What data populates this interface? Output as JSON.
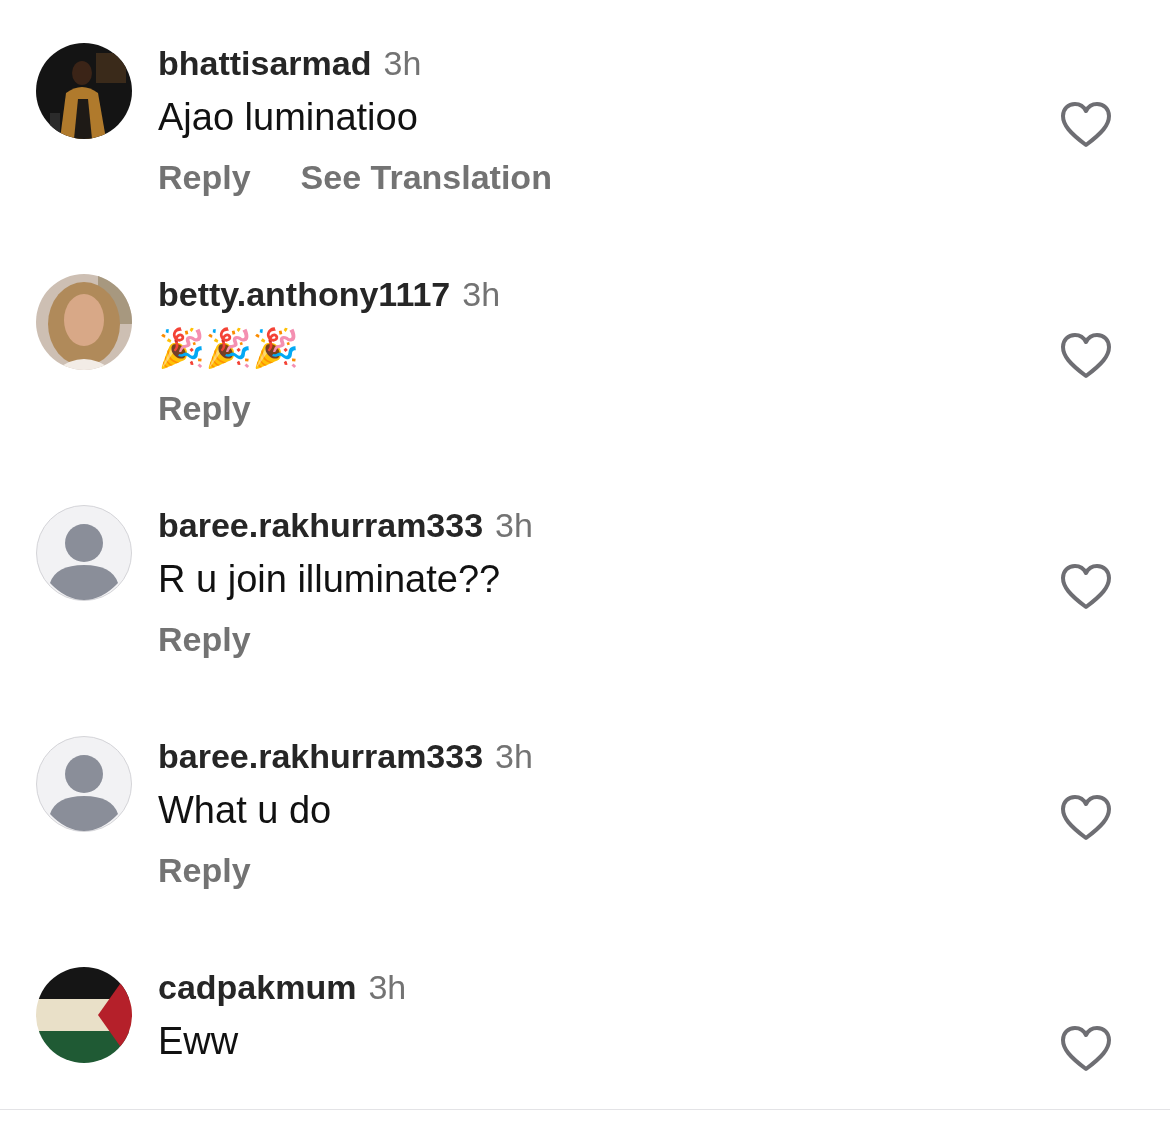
{
  "comments": [
    {
      "avatar": {
        "kind": "picture"
      },
      "username": "bhattisarmad",
      "time": "3h",
      "kind": "text",
      "text": "Ajao luminatioo",
      "actions": [
        "Reply",
        "See Translation"
      ],
      "liked": false
    },
    {
      "avatar": {
        "kind": "picture"
      },
      "username": "betty.anthony1117",
      "time": "3h",
      "kind": "text",
      "text": "🎉🎉🎉",
      "actions": [
        "Reply"
      ],
      "liked": false
    },
    {
      "avatar": {
        "kind": "default"
      },
      "username": "baree.rakhurram333",
      "time": "3h",
      "kind": "text",
      "text": "R u join illuminate??",
      "actions": [
        "Reply"
      ],
      "liked": false
    },
    {
      "avatar": {
        "kind": "default"
      },
      "username": "baree.rakhurram333",
      "time": "3h",
      "kind": "text",
      "text": "What u do",
      "actions": [
        "Reply"
      ],
      "liked": false
    },
    {
      "avatar": {
        "kind": "picture"
      },
      "username": "cadpakmum",
      "time": "3h",
      "kind": "text",
      "text": "Eww",
      "liked": false
    }
  ]
}
